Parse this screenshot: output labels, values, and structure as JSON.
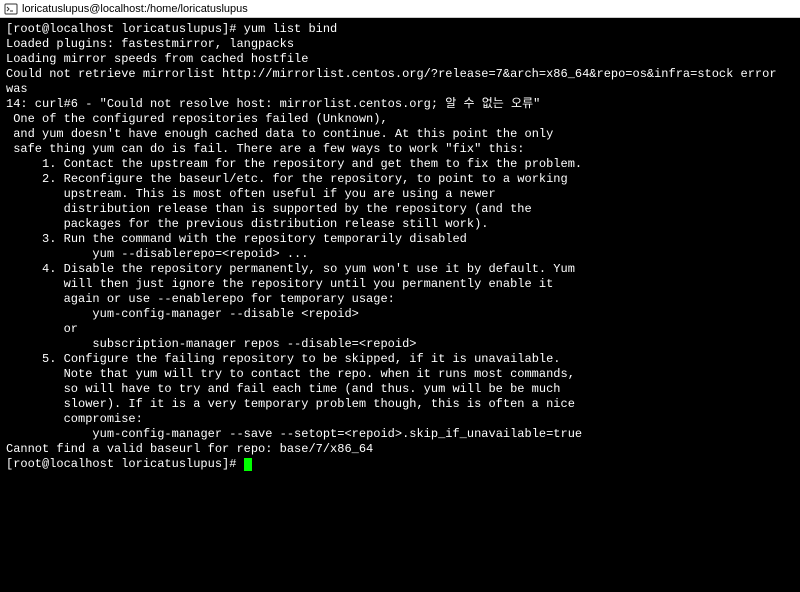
{
  "titlebar": {
    "title": "loricatuslupus@localhost:/home/loricatuslupus"
  },
  "terminal": {
    "prompt1": "[root@localhost loricatuslupus]# ",
    "command1": "yum list bind",
    "line1": "Loaded plugins: fastestmirror, langpacks",
    "line2": "Loading mirror speeds from cached hostfile",
    "line3": "Could not retrieve mirrorlist http://mirrorlist.centos.org/?release=7&arch=x86_64&repo=os&infra=stock error was",
    "line4": "14: curl#6 - \"Could not resolve host: mirrorlist.centos.org; 알 수 없는 오류\"",
    "blank1": "",
    "blank2": "",
    "err1": " One of the configured repositories failed (Unknown),",
    "err2": " and yum doesn't have enough cached data to continue. At this point the only",
    "err3": " safe thing yum can do is fail. There are a few ways to work \"fix\" this:",
    "blank3": "",
    "opt1": "     1. Contact the upstream for the repository and get them to fix the problem.",
    "blank4": "",
    "opt2a": "     2. Reconfigure the baseurl/etc. for the repository, to point to a working",
    "opt2b": "        upstream. This is most often useful if you are using a newer",
    "opt2c": "        distribution release than is supported by the repository (and the",
    "opt2d": "        packages for the previous distribution release still work).",
    "blank5": "",
    "opt3a": "     3. Run the command with the repository temporarily disabled",
    "opt3b": "            yum --disablerepo=<repoid> ...",
    "blank6": "",
    "opt4a": "     4. Disable the repository permanently, so yum won't use it by default. Yum",
    "opt4b": "        will then just ignore the repository until you permanently enable it",
    "opt4c": "        again or use --enablerepo for temporary usage:",
    "blank7": "",
    "opt4d": "            yum-config-manager --disable <repoid>",
    "opt4e": "        or",
    "opt4f": "            subscription-manager repos --disable=<repoid>",
    "blank8": "",
    "opt5a": "     5. Configure the failing repository to be skipped, if it is unavailable.",
    "opt5b": "        Note that yum will try to contact the repo. when it runs most commands,",
    "opt5c": "        so will have to try and fail each time (and thus. yum will be be much",
    "opt5d": "        slower). If it is a very temporary problem though, this is often a nice",
    "opt5e": "        compromise:",
    "blank9": "",
    "opt5f": "            yum-config-manager --save --setopt=<repoid>.skip_if_unavailable=true",
    "blank10": "",
    "err4": "Cannot find a valid baseurl for repo: base/7/x86_64",
    "prompt2": "[root@localhost loricatuslupus]# "
  }
}
